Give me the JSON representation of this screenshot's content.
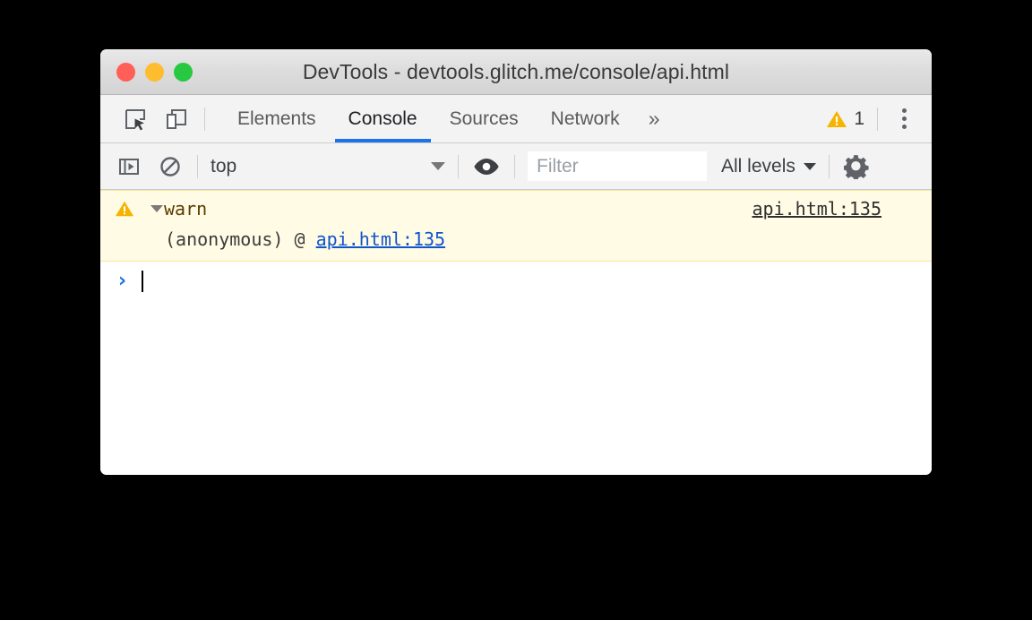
{
  "window": {
    "title": "DevTools - devtools.glitch.me/console/api.html",
    "traffic_lights": [
      {
        "name": "close",
        "color": "#ff5f56"
      },
      {
        "name": "minimize",
        "color": "#febc2e"
      },
      {
        "name": "zoom",
        "color": "#28c840"
      }
    ]
  },
  "tabbar": {
    "inspect_icon": "inspect-element-icon",
    "device_icon": "device-toolbar-icon",
    "tabs": [
      {
        "label": "Elements",
        "active": false
      },
      {
        "label": "Console",
        "active": true
      },
      {
        "label": "Sources",
        "active": false
      },
      {
        "label": "Network",
        "active": false
      }
    ],
    "more_tabs_label": "»",
    "warning_icon": "warning-triangle-icon",
    "warning_count": "1",
    "menu_icon": "kebab-menu-icon",
    "active_tab_color": "#1a73e8"
  },
  "console_toolbar": {
    "sidebar_toggle_icon": "console-sidebar-toggle-icon",
    "clear_icon": "clear-console-icon",
    "context": {
      "value": "top",
      "caret_icon": "chevron-down-icon"
    },
    "eye_icon": "live-expression-eye-icon",
    "filter": {
      "value": "",
      "placeholder": "Filter"
    },
    "levels": {
      "value": "All levels",
      "caret_icon": "chevron-down-icon"
    },
    "settings_icon": "gear-icon"
  },
  "console_output": {
    "messages": [
      {
        "level": "warning",
        "icon": "warning-triangle-icon",
        "disclosure_icon": "triangle-down-icon",
        "expanded": true,
        "text": "warn",
        "source_link": "api.html:135",
        "stack": [
          {
            "frame": "(anonymous) @ ",
            "link": "api.html:135"
          }
        ],
        "background": "#fffbe5",
        "border_color": "#f5e8a0",
        "text_color": "#5c3c00"
      }
    ],
    "prompt": {
      "chevron": "›",
      "value": "",
      "chevron_color": "#1a73e8"
    }
  }
}
